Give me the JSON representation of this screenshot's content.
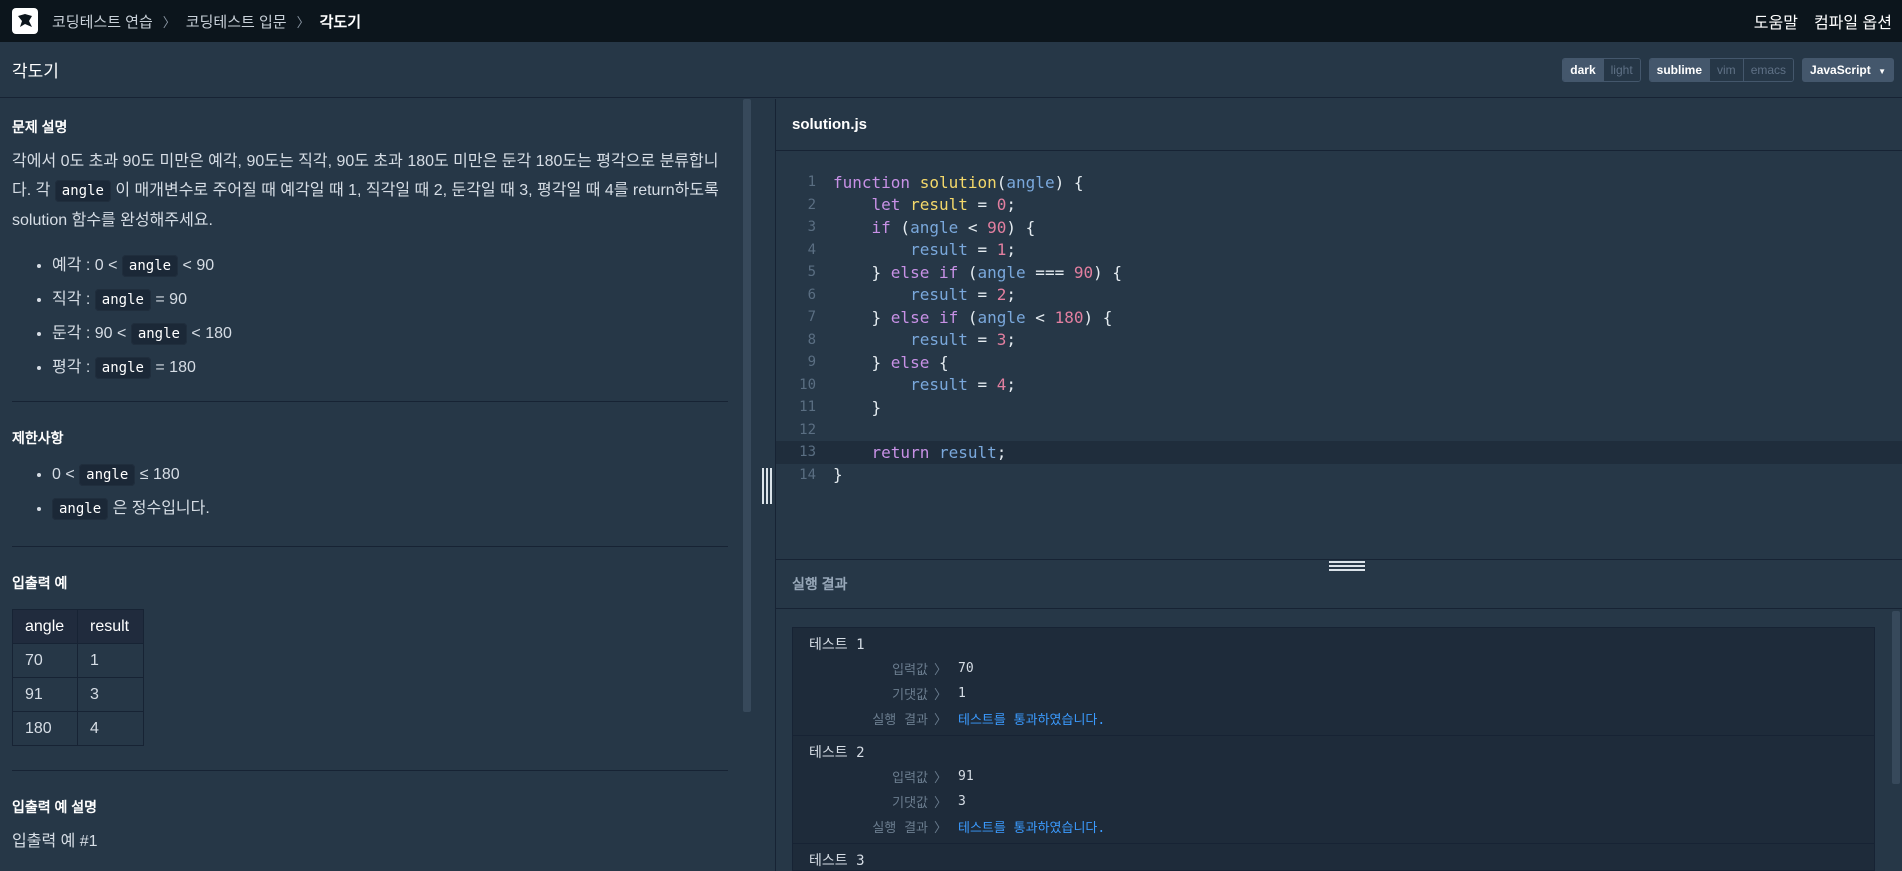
{
  "nav": {
    "breadcrumb": [
      "코딩테스트 연습",
      "코딩테스트 입문",
      "각도기"
    ],
    "help": "도움말",
    "compile_options": "컴파일 옵션"
  },
  "header": {
    "title": "각도기",
    "theme": [
      "dark",
      "light"
    ],
    "keymap": [
      "sublime",
      "vim",
      "emacs"
    ],
    "language": "JavaScript"
  },
  "problem": {
    "section_title": "문제 설명",
    "desc_part1": "각에서 0도 초과 90도 미만은 예각, 90도는 직각, 90도 초과 180도 미만은 둔각 180도는 평각으로 분류합니다. 각 ",
    "desc_code": "angle",
    "desc_part2": "이 매개변수로 주어질 때 예각일 때 1, 직각일 때 2, 둔각일 때 3, 평각일 때 4를 return하도록 solution 함수를 완성해주세요.",
    "bullets": [
      {
        "pre": "예각 : 0 < ",
        "code": "angle",
        "post": " < 90"
      },
      {
        "pre": "직각 : ",
        "code": "angle",
        "post": " = 90"
      },
      {
        "pre": "둔각 : 90 < ",
        "code": "angle",
        "post": " < 180"
      },
      {
        "pre": "평각 : ",
        "code": "angle",
        "post": " = 180"
      }
    ],
    "constraints_title": "제한사항",
    "constraints": [
      {
        "pre": "0 < ",
        "code": "angle",
        "post": " ≤ 180"
      },
      {
        "pre": "",
        "code": "angle",
        "post": " 은 정수입니다."
      }
    ],
    "examples_title": "입출력 예",
    "table_headers": [
      "angle",
      "result"
    ],
    "table_rows": [
      [
        "70",
        "1"
      ],
      [
        "91",
        "3"
      ],
      [
        "180",
        "4"
      ]
    ],
    "explain_title": "입출력 예 설명",
    "explain_sub": "입출력 예 #1"
  },
  "editor": {
    "filename": "solution.js",
    "line_numbers": [
      "1",
      "2",
      "3",
      "4",
      "5",
      "6",
      "7",
      "8",
      "9",
      "10",
      "11",
      "12",
      "13",
      "14"
    ]
  },
  "results": {
    "title": "실행 결과",
    "input_label": "입력값",
    "expected_label": "기댓값",
    "result_label": "실행 결과",
    "tests": [
      {
        "name": "테스트 1",
        "input": "70",
        "expected": "1",
        "result": "테스트를 통과하였습니다."
      },
      {
        "name": "테스트 2",
        "input": "91",
        "expected": "3",
        "result": "테스트를 통과하였습니다."
      },
      {
        "name": "테스트 3"
      }
    ]
  }
}
